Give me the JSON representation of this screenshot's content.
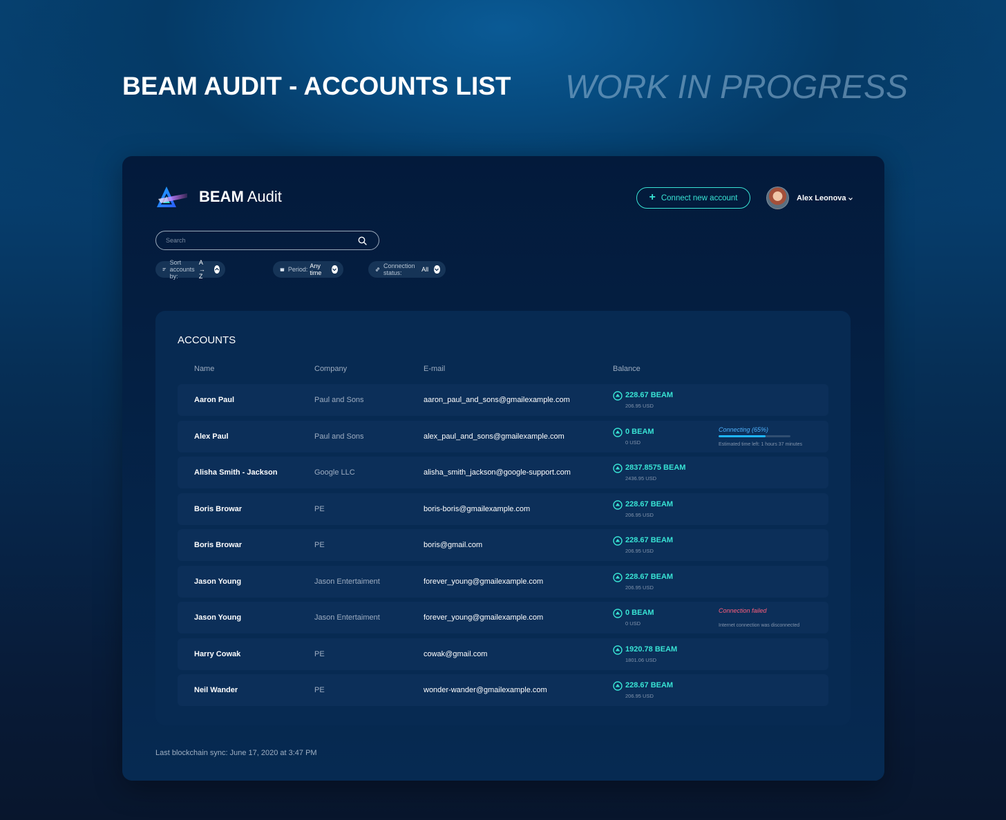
{
  "hero": {
    "title": "BEAM AUDIT - ACCOUNTS LIST",
    "wip": "WORK IN PROGRESS"
  },
  "header": {
    "brand_bold": "BEAM",
    "brand_light": "Audit",
    "connect_label": "Connect new account",
    "user_name": "Alex Leonova"
  },
  "search": {
    "placeholder": "Search"
  },
  "filters": [
    {
      "label": "Sort accounts by:",
      "value": "A → Z"
    },
    {
      "label": "Period:",
      "value": "Any time"
    },
    {
      "label": "Connection status:",
      "value": "All"
    }
  ],
  "accounts": {
    "title": "ACCOUNTS",
    "columns": [
      "Name",
      "Company",
      "E-mail",
      "Balance"
    ],
    "rows": [
      {
        "name": "Aaron Paul",
        "company": "Paul and Sons",
        "email": "aaron_paul_and_sons@gmailexample.com",
        "beam": "228.67 BEAM",
        "usd": "206.95 USD"
      },
      {
        "name": "Alex Paul",
        "company": "Paul and Sons",
        "email": "alex_paul_and_sons@gmailexample.com",
        "beam": "0 BEAM",
        "usd": "0 USD",
        "status": {
          "kind": "connecting",
          "title": "Connecting (65%)",
          "note": "Estimated time left: 1 hours 37 minutes",
          "progress": 0.65
        }
      },
      {
        "name": "Alisha Smith - Jackson",
        "company": "Google LLC",
        "email": "alisha_smith_jackson@google-support.com",
        "beam": "2837.8575 BEAM",
        "usd": "2436.95 USD"
      },
      {
        "name": "Boris Browar",
        "company": "PE",
        "email": "boris-boris@gmailexample.com",
        "beam": "228.67 BEAM",
        "usd": "206.95 USD"
      },
      {
        "name": "Boris Browar",
        "company": "PE",
        "email": "boris@gmail.com",
        "beam": "228.67 BEAM",
        "usd": "206.95 USD"
      },
      {
        "name": "Jason Young",
        "company": "Jason Entertaiment",
        "email": "forever_young@gmailexample.com",
        "beam": "228.67 BEAM",
        "usd": "206.95 USD"
      },
      {
        "name": "Jason Young",
        "company": "Jason Entertaiment",
        "email": "forever_young@gmailexample.com",
        "beam": "0 BEAM",
        "usd": "0 USD",
        "status": {
          "kind": "failed",
          "title": "Connection failed",
          "note": "Internet connection was disconnected"
        }
      },
      {
        "name": "Harry Cowak",
        "company": "PE",
        "email": "cowak@gmail.com",
        "beam": "1920.78 BEAM",
        "usd": "1801.06 USD"
      },
      {
        "name": "Neil Wander",
        "company": "PE",
        "email": "wonder-wander@gmailexample.com",
        "beam": "228.67 BEAM",
        "usd": "206.95 USD"
      }
    ]
  },
  "footer": {
    "sync": "Last blockchain sync: June 17, 2020 at 3:47 PM"
  },
  "colors": {
    "accent": "#38e3d4",
    "progress": "#1fb6ff",
    "error": "#ff5f7e",
    "connecting": "#4fb3ff"
  },
  "icons": [
    "beam-logo-icon",
    "plus-icon",
    "chevron-down-icon",
    "search-icon",
    "sort-icon",
    "calendar-icon",
    "link-icon",
    "beam-coin-icon"
  ]
}
